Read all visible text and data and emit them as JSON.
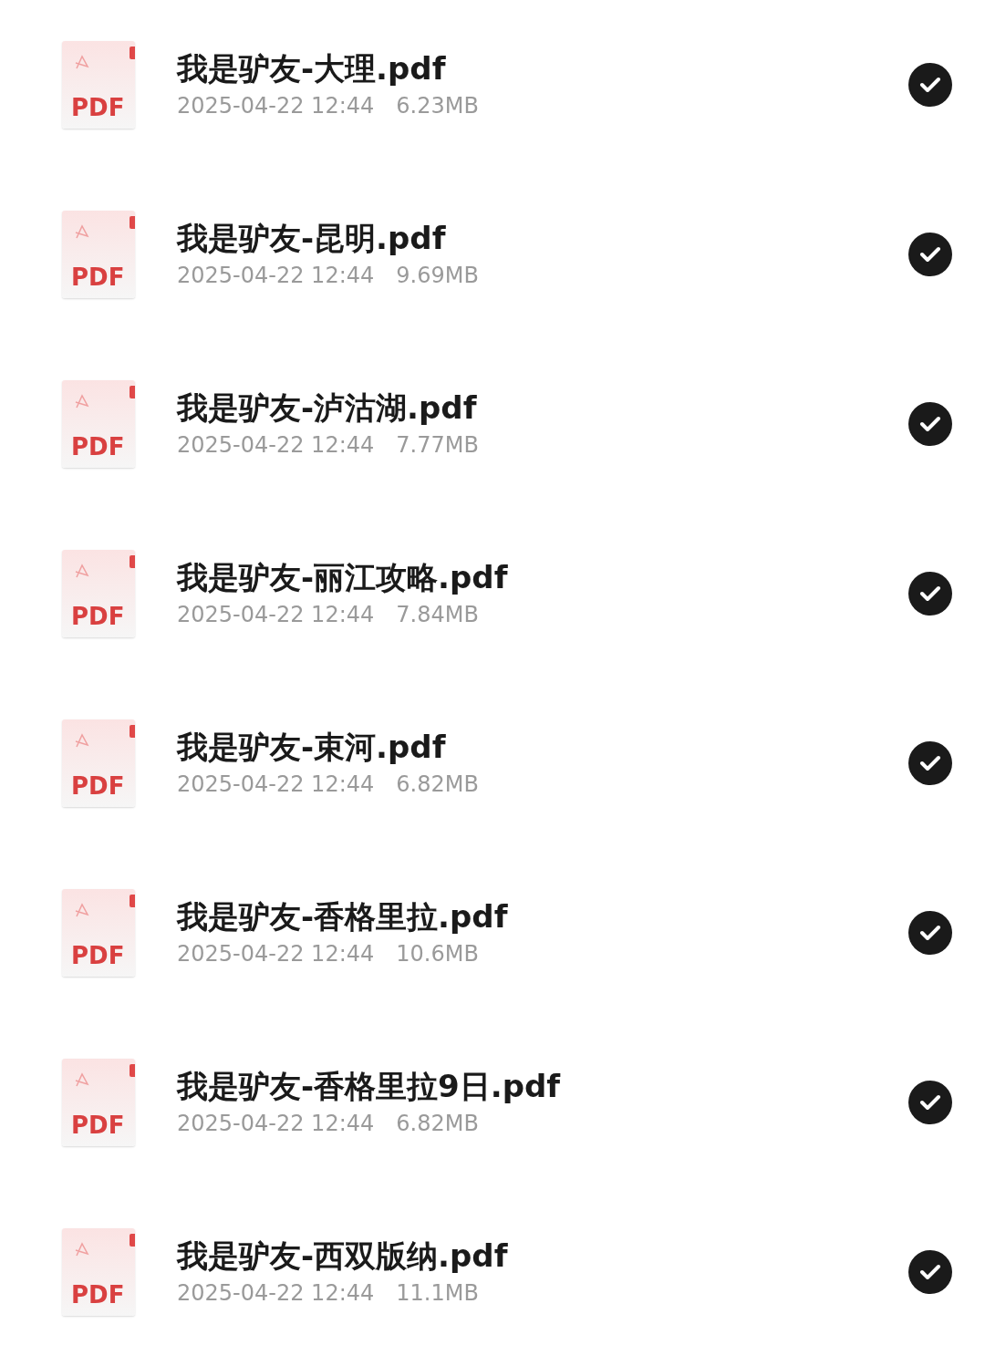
{
  "files": [
    {
      "name": "我是驴友-大理.pdf",
      "date": "2025-04-22 12:44",
      "size": "6.23MB",
      "icon_label": "PDF",
      "selected": true
    },
    {
      "name": "我是驴友-昆明.pdf",
      "date": "2025-04-22 12:44",
      "size": "9.69MB",
      "icon_label": "PDF",
      "selected": true
    },
    {
      "name": "我是驴友-泸沽湖.pdf",
      "date": "2025-04-22 12:44",
      "size": "7.77MB",
      "icon_label": "PDF",
      "selected": true
    },
    {
      "name": "我是驴友-丽江攻略.pdf",
      "date": "2025-04-22 12:44",
      "size": "7.84MB",
      "icon_label": "PDF",
      "selected": true
    },
    {
      "name": "我是驴友-束河.pdf",
      "date": "2025-04-22 12:44",
      "size": "6.82MB",
      "icon_label": "PDF",
      "selected": true
    },
    {
      "name": "我是驴友-香格里拉.pdf",
      "date": "2025-04-22 12:44",
      "size": "10.6MB",
      "icon_label": "PDF",
      "selected": true
    },
    {
      "name": "我是驴友-香格里拉9日.pdf",
      "date": "2025-04-22 12:44",
      "size": "6.82MB",
      "icon_label": "PDF",
      "selected": true
    },
    {
      "name": "我是驴友-西双版纳.pdf",
      "date": "2025-04-22 12:44",
      "size": "11.1MB",
      "icon_label": "PDF",
      "selected": true
    }
  ]
}
